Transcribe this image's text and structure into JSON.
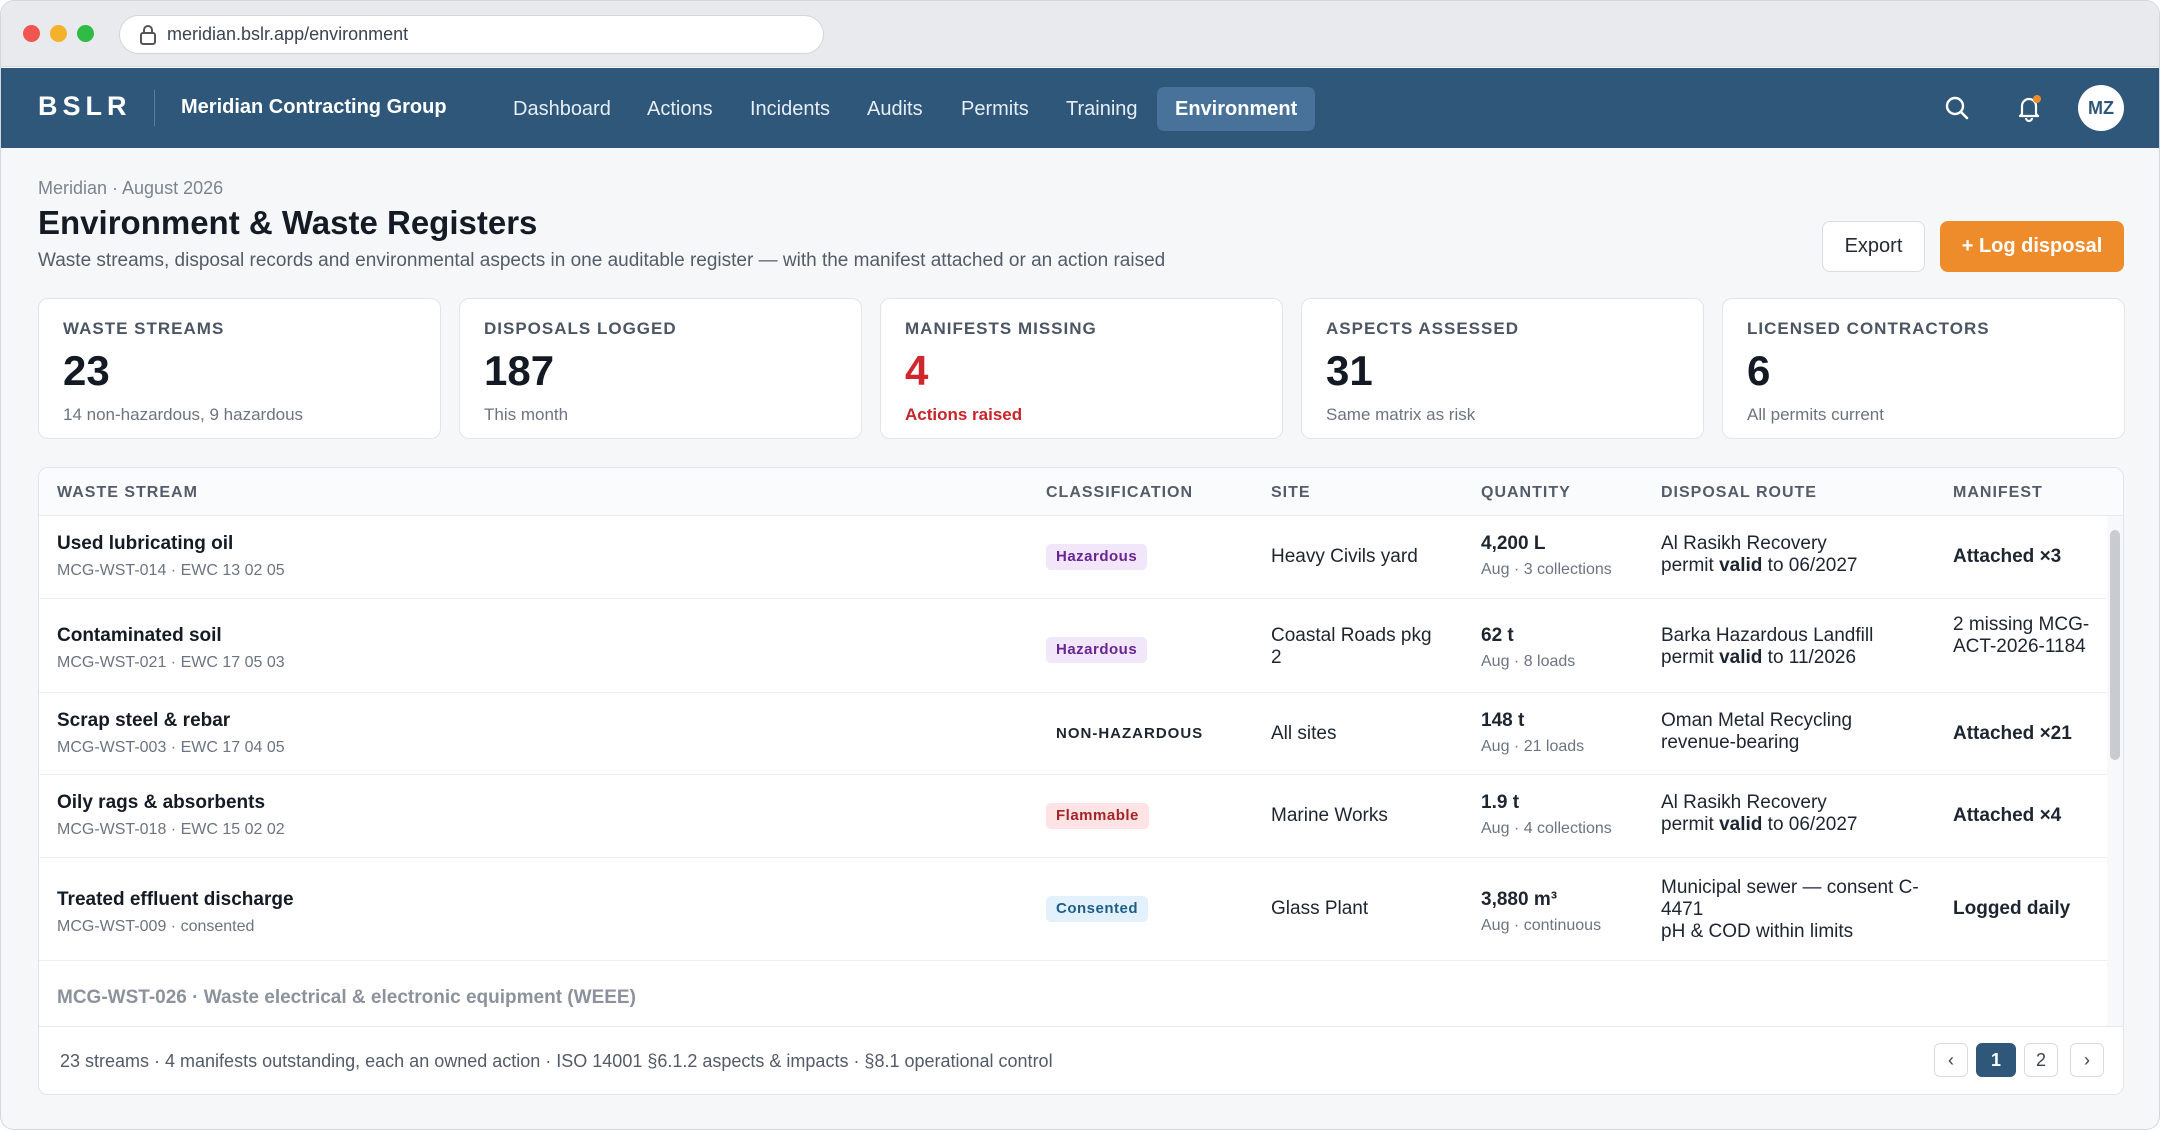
{
  "browser": {
    "url_host": "meridian.bslr.app",
    "url_path": "/environment"
  },
  "topbar": {
    "logo": "BSLR",
    "org": "Meridian Contracting Group",
    "nav": [
      "Dashboard",
      "Actions",
      "Incidents",
      "Audits",
      "Permits",
      "Training",
      "Environment"
    ],
    "active": "Environment",
    "avatar": "MZ",
    "icons": [
      "search-icon",
      "bell-icon"
    ]
  },
  "page": {
    "crumb": "Meridian · August 2026",
    "title": "Environment & Waste Registers",
    "subtitle": "Waste streams, disposal records and environmental aspects in one auditable register — with the manifest attached or an action raised",
    "export": "Export",
    "log_disposal": "+ Log disposal"
  },
  "cards": [
    {
      "label": "WASTE STREAMS",
      "value": "23",
      "note": "14 non-hazardous, 9 hazardous"
    },
    {
      "label": "DISPOSALS LOGGED",
      "value": "187",
      "note": "This month"
    },
    {
      "label": "MANIFESTS MISSING",
      "value": "4",
      "note": "Actions raised"
    },
    {
      "label": "ASPECTS ASSESSED",
      "value": "31",
      "note": "Same matrix as risk"
    },
    {
      "label": "LICENSED CONTRACTORS",
      "value": "6",
      "note": "All permits current"
    }
  ],
  "table": {
    "headers": [
      "WASTE STREAM",
      "CLASSIFICATION",
      "SITE",
      "QUANTITY",
      "DISPOSAL ROUTE",
      "MANIFEST"
    ],
    "rows": [
      {
        "name": "Used lubricating oil",
        "code": "MCG-WST-014 · EWC 13 02 05",
        "class": "Hazardous",
        "site": "Heavy Civils yard",
        "qty": "4,200 L",
        "qty_sub": "Aug · 3 collections",
        "route1": "Al Rasikh Recovery",
        "route_pre": "permit ",
        "route_bold": "valid",
        "route_post": " to 06/2027",
        "manifest": "Attached ×3"
      },
      {
        "name": "Contaminated soil",
        "code": "MCG-WST-021 · EWC 17 05 03",
        "class": "Hazardous",
        "site": "Coastal Roads pkg 2",
        "qty": "62 t",
        "qty_sub": "Aug · 8 loads",
        "route1": "Barka Hazardous Landfill",
        "route_pre": "permit ",
        "route_bold": "valid",
        "route_post": " to 11/2026",
        "manifest": "2 missing MCG-ACT-2026-1184"
      },
      {
        "name": "Scrap steel & rebar",
        "code": "MCG-WST-003 · EWC 17 04 05",
        "class": "NON-HAZARDOUS",
        "site": "All sites",
        "qty": "148 t",
        "qty_sub": "Aug · 21 loads",
        "route1": "Oman Metal Recycling",
        "route2": "revenue-bearing",
        "manifest": "Attached ×21"
      },
      {
        "name": "Oily rags & absorbents",
        "code": "MCG-WST-018 · EWC 15 02 02",
        "class": "Flammable",
        "site": "Marine Works",
        "qty": "1.9 t",
        "qty_sub": "Aug · 4 collections",
        "route1": "Al Rasikh Recovery",
        "route_pre": "permit ",
        "route_bold": "valid",
        "route_post": " to 06/2027",
        "manifest": "Attached ×4"
      },
      {
        "name": "Treated effluent discharge",
        "code": "MCG-WST-009 · consented",
        "class": "Consented",
        "site": "Glass Plant",
        "qty": "3,880 m³",
        "qty_sub": "Aug · continuous",
        "route1": "Municipal sewer — consent C-4471",
        "route2": "pH & COD within limits",
        "manifest": "Logged daily"
      }
    ],
    "partial_row": "MCG-WST-026 · Waste electrical & electronic equipment (WEEE)",
    "footer": "23 streams · 4 manifests outstanding, each an owned action · ISO 14001 §6.1.2 aspects & impacts · §8.1 operational control",
    "pages": [
      "‹",
      "1",
      "2",
      "›"
    ],
    "current_page": "1"
  },
  "colors": {
    "brand": "#2e5779",
    "accent": "#ee8c2c",
    "danger": "#d0272d"
  }
}
